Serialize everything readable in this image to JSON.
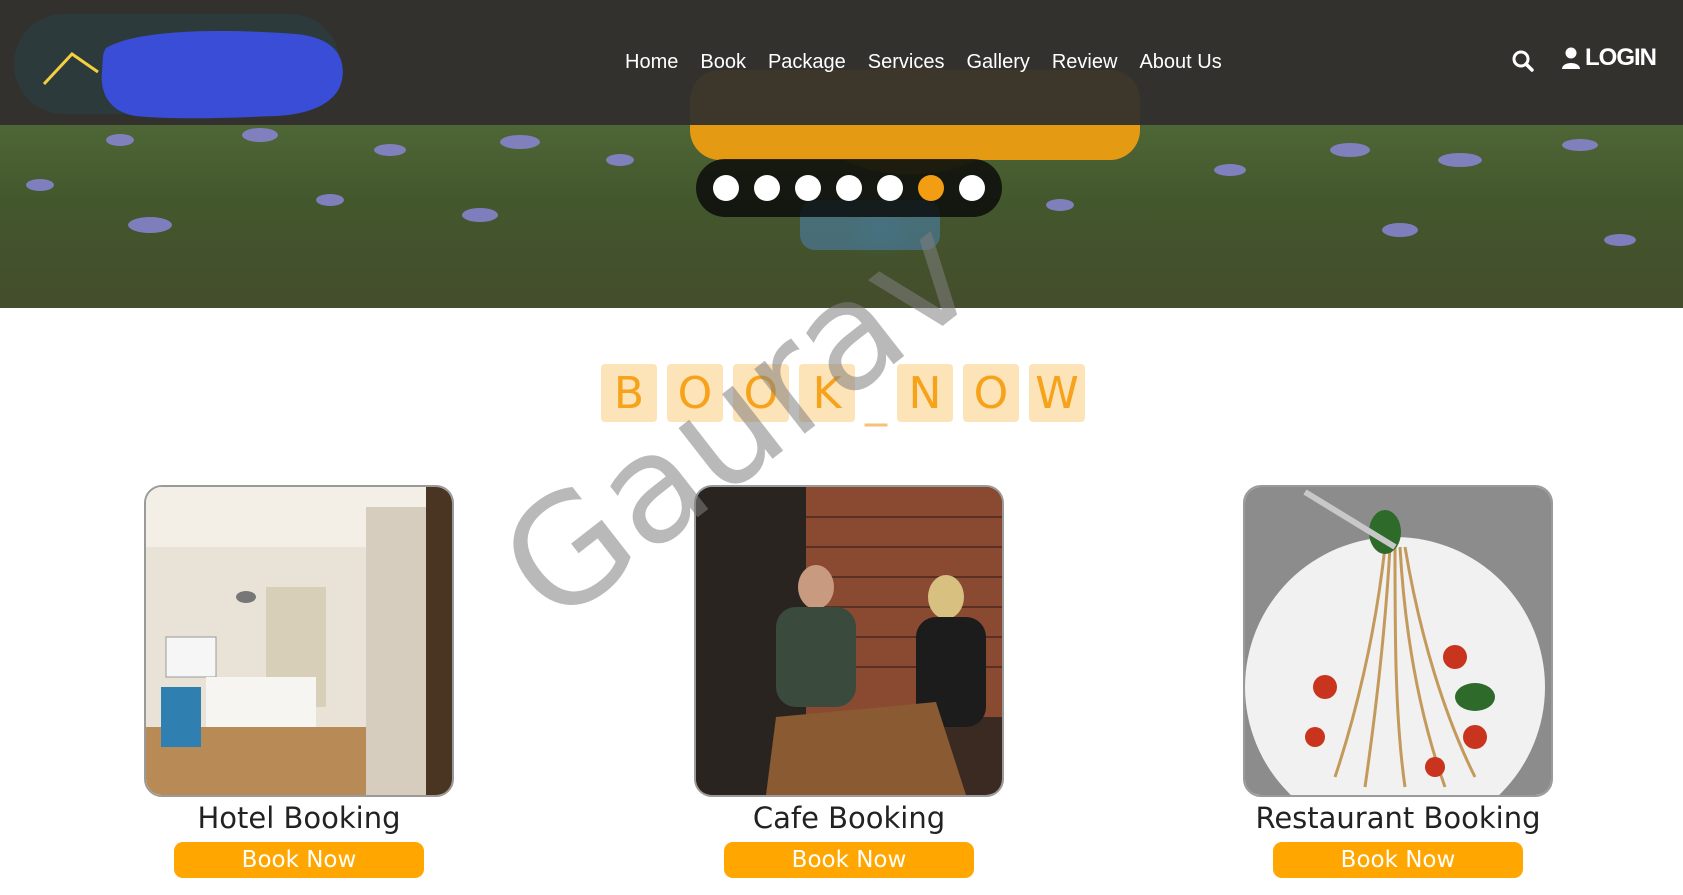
{
  "nav": {
    "links": [
      "Home",
      "Book",
      "Package",
      "Services",
      "Gallery",
      "Review",
      "About Us"
    ],
    "login_label": "LOGIN"
  },
  "slider": {
    "count": 7,
    "active_index": 5
  },
  "section_title": {
    "letters": [
      "B",
      "O",
      "O",
      "K",
      "_",
      "N",
      "O",
      "W"
    ]
  },
  "cards": [
    {
      "title": "Hotel Booking",
      "button": "Book Now"
    },
    {
      "title": "Cafe Booking",
      "button": "Book Now"
    },
    {
      "title": "Restaurant Booking",
      "button": "Book Now"
    }
  ],
  "watermark": "Gaurav",
  "colors": {
    "accent": "#ffa600",
    "nav_bg": "#302e2c",
    "tile_bg": "#fde3b8",
    "tile_text": "#f6a21a"
  },
  "icons": [
    "search-icon",
    "user-icon",
    "logo-roof-icon"
  ]
}
